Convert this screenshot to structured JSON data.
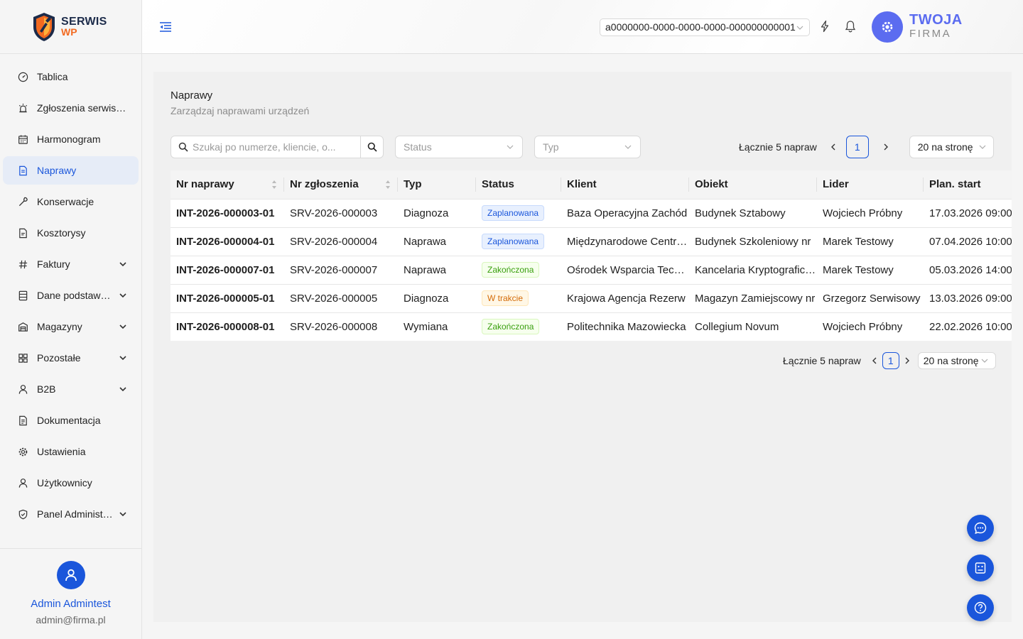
{
  "brand": {
    "line1": "SERWIS",
    "line2": "WP",
    "accent": "#1a56db",
    "orange": "#f26a21"
  },
  "sidebar": {
    "items": [
      {
        "label": "Tablica",
        "icon": "dashboard-icon",
        "expandable": false,
        "active": false
      },
      {
        "label": "Zgłoszenia serwisowe",
        "icon": "alarm-icon",
        "expandable": false,
        "active": false
      },
      {
        "label": "Harmonogram",
        "icon": "calendar-icon",
        "expandable": false,
        "active": false
      },
      {
        "label": "Naprawy",
        "icon": "document-icon",
        "expandable": false,
        "active": true
      },
      {
        "label": "Konserwacje",
        "icon": "wrench-icon",
        "expandable": false,
        "active": false
      },
      {
        "label": "Kosztorysy",
        "icon": "file-icon",
        "expandable": false,
        "active": false
      },
      {
        "label": "Faktury",
        "icon": "hash-icon",
        "expandable": true,
        "active": false
      },
      {
        "label": "Dane podstawowe",
        "icon": "database-icon",
        "expandable": true,
        "active": false
      },
      {
        "label": "Magazyny",
        "icon": "warehouse-icon",
        "expandable": true,
        "active": false
      },
      {
        "label": "Pozostałe",
        "icon": "grid-icon",
        "expandable": true,
        "active": false
      },
      {
        "label": "B2B",
        "icon": "user-icon",
        "expandable": true,
        "active": false
      },
      {
        "label": "Dokumentacja",
        "icon": "file-text-icon",
        "expandable": false,
        "active": false
      },
      {
        "label": "Ustawienia",
        "icon": "gear-icon",
        "expandable": false,
        "active": false
      },
      {
        "label": "Użytkownicy",
        "icon": "user-icon",
        "expandable": false,
        "active": false
      },
      {
        "label": "Panel Administratora",
        "icon": "shield-icon",
        "expandable": true,
        "active": false
      }
    ],
    "user": {
      "name": "Admin Admintest",
      "email": "admin@firma.pl"
    }
  },
  "header": {
    "tenant": "a0000000-0000-0000-0000-000000000001",
    "company_line1": "TWOJA",
    "company_line2": "FIRMA"
  },
  "page": {
    "title": "Naprawy",
    "subtitle": "Zarządzaj naprawami urządzeń",
    "search_placeholder": "Szukaj po numerze, kliencie, o...",
    "status_placeholder": "Status",
    "type_placeholder": "Typ",
    "total": "Łącznie 5 napraw",
    "current_page": "1",
    "page_size": "20 na stronę"
  },
  "table": {
    "columns": [
      "Nr naprawy",
      "Nr zgłoszenia",
      "Typ",
      "Status",
      "Klient",
      "Obiekt",
      "Lider",
      "Plan. start"
    ],
    "rows": [
      {
        "nr": "INT-2026-000003-01",
        "zgl": "SRV-2026-000003",
        "typ": "Diagnoza",
        "status": "Zaplanowana",
        "status_color": "blue",
        "klient": "Baza Operacyjna Zachód",
        "obiekt": "Budynek Sztabowy",
        "lider": "Wojciech Próbny",
        "start": "17.03.2026 09:00"
      },
      {
        "nr": "INT-2026-000004-01",
        "zgl": "SRV-2026-000004",
        "typ": "Naprawa",
        "status": "Zaplanowana",
        "status_color": "blue",
        "klient": "Międzynarodowe Centrum",
        "obiekt": "Budynek Szkoleniowy nr",
        "lider": "Marek Testowy",
        "start": "07.04.2026 10:00"
      },
      {
        "nr": "INT-2026-000007-01",
        "zgl": "SRV-2026-000007",
        "typ": "Naprawa",
        "status": "Zakończona",
        "status_color": "green",
        "klient": "Ośrodek Wsparcia Technicznego",
        "obiekt": "Kancelaria Kryptograficzna",
        "lider": "Marek Testowy",
        "start": "05.03.2026 14:00"
      },
      {
        "nr": "INT-2026-000005-01",
        "zgl": "SRV-2026-000005",
        "typ": "Diagnoza",
        "status": "W trakcie",
        "status_color": "orange",
        "klient": "Krajowa Agencja Rezerw",
        "obiekt": "Magazyn Zamiejscowy nr",
        "lider": "Grzegorz Serwisowy",
        "start": "13.03.2026 09:00"
      },
      {
        "nr": "INT-2026-000008-01",
        "zgl": "SRV-2026-000008",
        "typ": "Wymiana",
        "status": "Zakończona",
        "status_color": "green",
        "klient": "Politechnika Mazowiecka",
        "obiekt": "Collegium Novum",
        "lider": "Wojciech Próbny",
        "start": "22.02.2026 10:00"
      }
    ]
  },
  "fabs": [
    {
      "name": "chat-button",
      "icon": "chat-icon"
    },
    {
      "name": "robot-button",
      "icon": "robot-icon"
    },
    {
      "name": "help-button",
      "icon": "help-icon"
    }
  ]
}
